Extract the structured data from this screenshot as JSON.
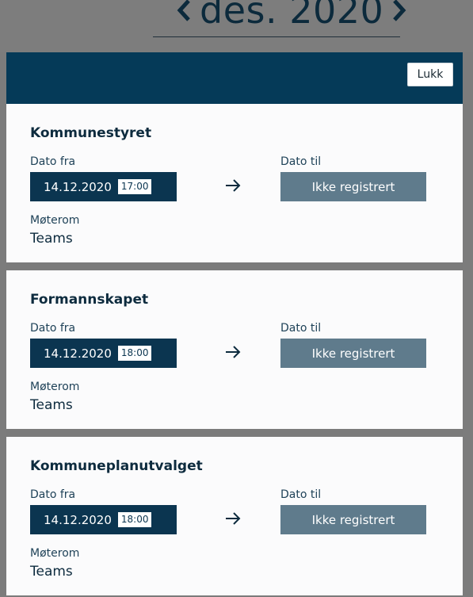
{
  "month_nav": {
    "label": "des. 2020"
  },
  "modal": {
    "close_label": "Lukk"
  },
  "cards": [
    {
      "title": "Kommunestyret",
      "from_label": "Dato fra",
      "from_date": "14.12.2020",
      "from_time": "17:00",
      "to_label": "Dato til",
      "to_value": "Ikke registrert",
      "room_label": "Møterom",
      "room_value": "Teams"
    },
    {
      "title": "Formannskapet",
      "from_label": "Dato fra",
      "from_date": "14.12.2020",
      "from_time": "18:00",
      "to_label": "Dato til",
      "to_value": "Ikke registrert",
      "room_label": "Møterom",
      "room_value": "Teams"
    },
    {
      "title": "Kommuneplanutvalget",
      "from_label": "Dato fra",
      "from_date": "14.12.2020",
      "from_time": "18:00",
      "to_label": "Dato til",
      "to_value": "Ikke registrert",
      "room_label": "Møterom",
      "room_value": "Teams"
    }
  ],
  "colors": {
    "header": "#053a58",
    "date_box": "#0b3550",
    "status_button": "#5f7b8c",
    "backdrop": "#7c7c7c"
  }
}
